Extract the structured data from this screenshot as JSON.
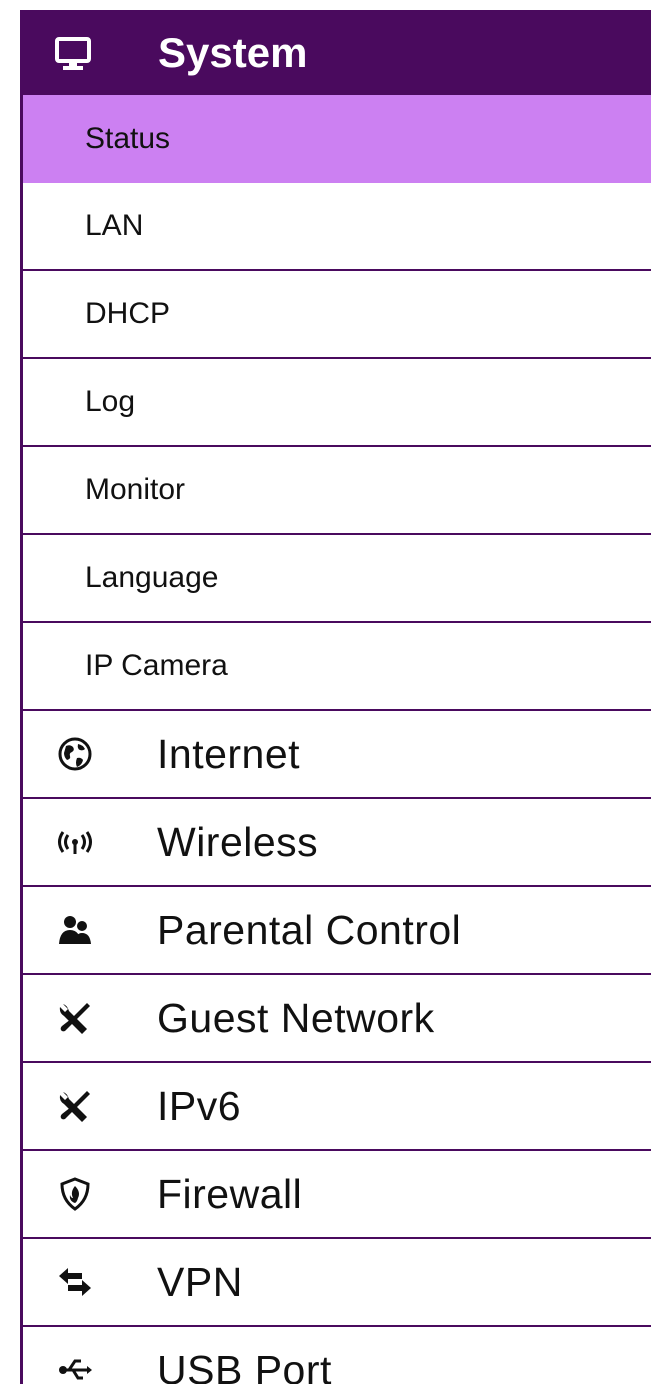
{
  "sidebar": {
    "header": {
      "label": "System",
      "icon": "monitor-icon"
    },
    "sub_items": [
      {
        "label": "Status",
        "active": true
      },
      {
        "label": "LAN"
      },
      {
        "label": "DHCP"
      },
      {
        "label": "Log"
      },
      {
        "label": "Monitor"
      },
      {
        "label": "Language"
      },
      {
        "label": "IP Camera"
      }
    ],
    "main_items": [
      {
        "label": "Internet",
        "icon": "globe-icon"
      },
      {
        "label": "Wireless",
        "icon": "wireless-icon"
      },
      {
        "label": "Parental Control",
        "icon": "users-icon"
      },
      {
        "label": "Guest Network",
        "icon": "tools-icon"
      },
      {
        "label": "IPv6",
        "icon": "tools-icon"
      },
      {
        "label": "Firewall",
        "icon": "shield-fire-icon"
      },
      {
        "label": "VPN",
        "icon": "exchange-icon"
      },
      {
        "label": "USB Port",
        "icon": "usb-icon"
      }
    ]
  },
  "colors": {
    "header_bg": "#4a0a5e",
    "active_bg": "#cc80f2",
    "border": "#4a0a5e"
  }
}
